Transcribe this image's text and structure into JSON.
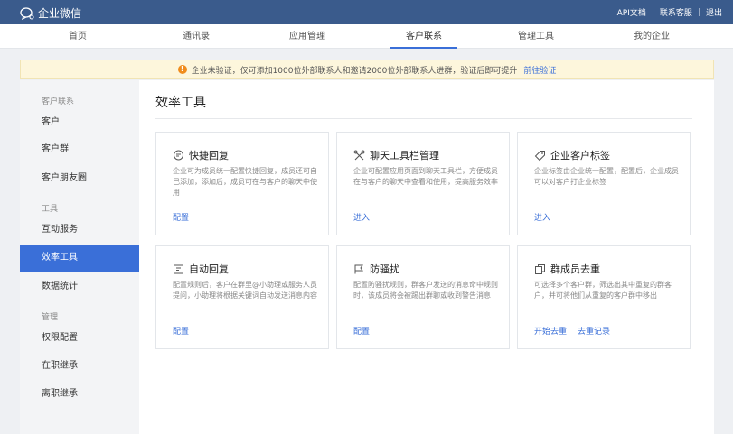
{
  "topbar": {
    "brand": "企业微信",
    "links": [
      "API文档",
      "联系客服",
      "退出"
    ]
  },
  "nav": {
    "tabs": [
      {
        "label": "首页"
      },
      {
        "label": "通讯录"
      },
      {
        "label": "应用管理"
      },
      {
        "label": "客户联系"
      },
      {
        "label": "管理工具"
      },
      {
        "label": "我的企业"
      }
    ],
    "active": "客户联系"
  },
  "notice": {
    "text": "企业未验证，仅可添加1000位外部联系人和邀请2000位外部联系人进群，验证后即可提升",
    "link": "前往验证"
  },
  "sidebar": {
    "groups": [
      "客户联系",
      "工具",
      "管理"
    ],
    "items": [
      "客户",
      "客户群",
      "客户朋友圈",
      "互动服务",
      "效率工具",
      "数据统计",
      "权限配置",
      "在职继承",
      "离职继承"
    ],
    "active": "效率工具"
  },
  "main": {
    "title": "效率工具",
    "cards": [
      {
        "title": "快捷回复",
        "icon": "chat-bubble-icon",
        "desc": "企业可为成员统一配置快捷回复，成员还可自己添加，添加后，成员可在与客户的聊天中使用",
        "actions": [
          "配置"
        ]
      },
      {
        "title": "聊天工具栏管理",
        "icon": "tools-icon",
        "desc": "企业可配置应用页面到聊天工具栏，方便成员在与客户的聊天中查看和使用，提高服务效率",
        "actions": [
          "进入"
        ]
      },
      {
        "title": "企业客户标签",
        "icon": "tag-icon",
        "desc": "企业标签由企业统一配置，配置后，企业成员可以对客户打企业标签",
        "actions": [
          "进入"
        ]
      },
      {
        "title": "自动回复",
        "icon": "auto-reply-icon",
        "desc": "配置规则后，客户在群里@小助理或服务人员提问，小助理将根据关键词自动发送消息内容",
        "actions": [
          "配置"
        ]
      },
      {
        "title": "防骚扰",
        "icon": "flag-icon",
        "desc": "配置防骚扰规则，群客户发送的消息命中规则时，该成员将会被踢出群聊或收到警告消息",
        "actions": [
          "配置"
        ]
      },
      {
        "title": "群成员去重",
        "icon": "copy-icon",
        "desc": "可选择多个客户群，筛选出其中重复的群客户，并可将他们从重复的客户群中移出",
        "actions": [
          "开始去重",
          "去重记录"
        ]
      }
    ]
  }
}
